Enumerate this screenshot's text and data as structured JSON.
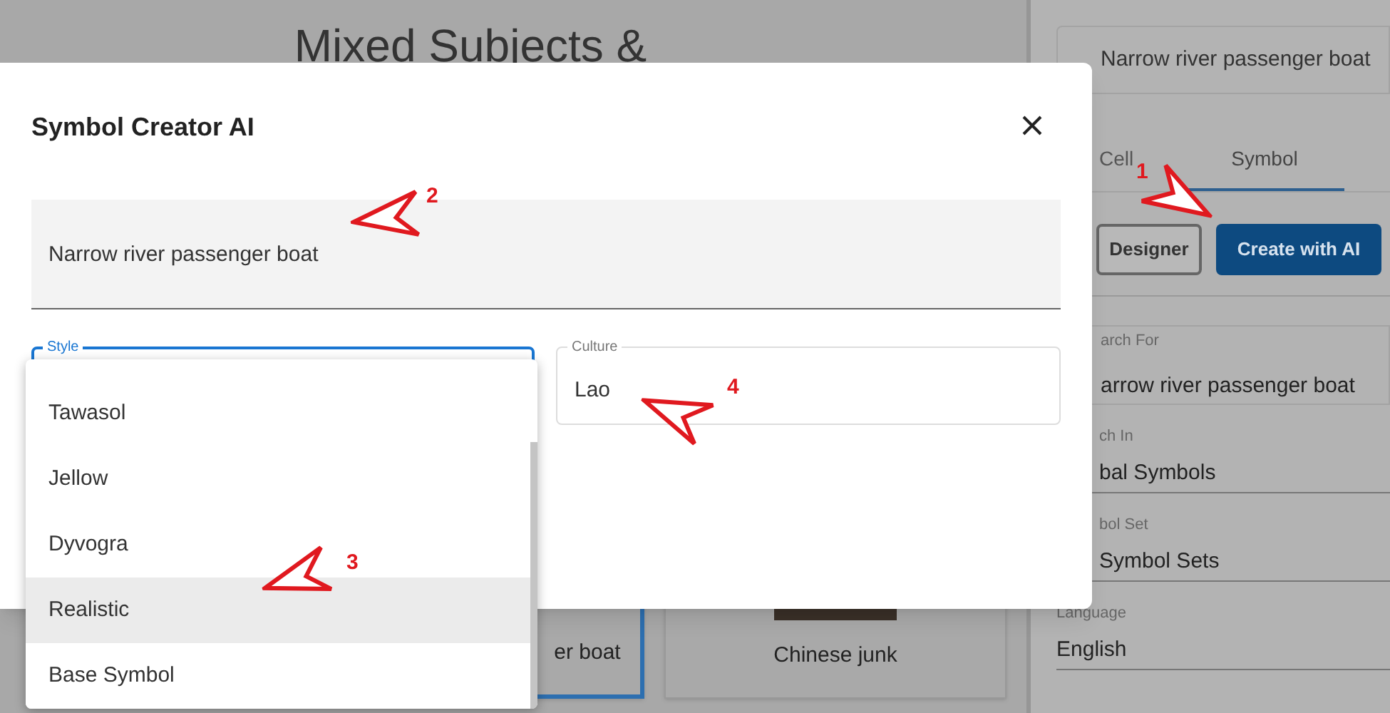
{
  "page": {
    "title": "Mixed Subjects &",
    "cards": [
      {
        "label": "er boat",
        "selected": true,
        "photo": false
      },
      {
        "label": "Chinese junk",
        "selected": false,
        "photo": true
      }
    ]
  },
  "side_panel": {
    "name_field": {
      "value": "Narrow river passenger boat"
    },
    "tabs": [
      {
        "label": "Cell",
        "selected": false
      },
      {
        "label": "Symbol",
        "selected": true
      }
    ],
    "buttons": [
      {
        "label": "Designer",
        "kind": "outline"
      },
      {
        "label": "Create with AI",
        "kind": "primary"
      }
    ],
    "fields": [
      {
        "label": "arch For",
        "value": "arrow river passenger boat",
        "kind": "outlined"
      },
      {
        "label": "ch In",
        "value": "bal Symbols",
        "kind": "underline"
      },
      {
        "label": "bol Set",
        "value": "Symbol Sets",
        "kind": "underline"
      },
      {
        "label": "Language",
        "value": "English",
        "kind": "underline"
      }
    ]
  },
  "dialog": {
    "title": "Symbol Creator AI",
    "prompt": {
      "value": "Narrow river passenger boat"
    },
    "style": {
      "label": "Style",
      "focused": true,
      "options": [
        {
          "label": "Tawasol",
          "selected": false
        },
        {
          "label": "Jellow",
          "selected": false
        },
        {
          "label": "Dyvogra",
          "selected": false
        },
        {
          "label": "Realistic",
          "selected": true
        },
        {
          "label": "Base Symbol",
          "selected": false
        }
      ]
    },
    "culture": {
      "label": "Culture",
      "value": "Lao"
    }
  },
  "annotations": [
    {
      "label": "1"
    },
    {
      "label": "2"
    },
    {
      "label": "3"
    },
    {
      "label": "4"
    }
  ]
}
